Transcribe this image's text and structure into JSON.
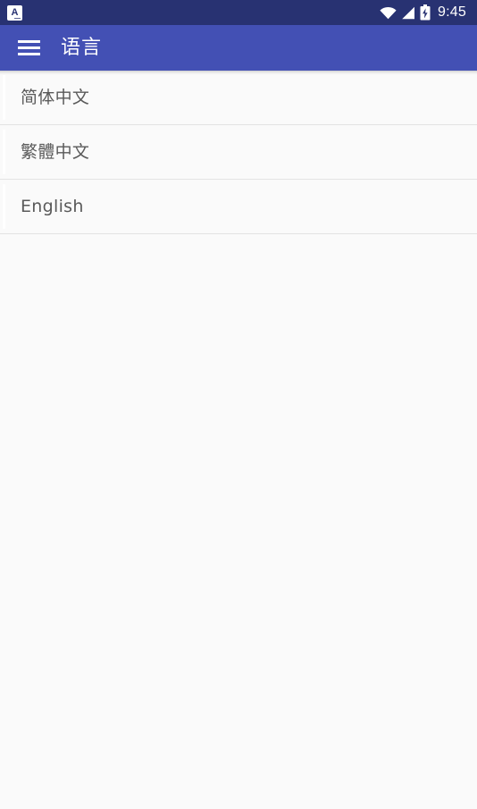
{
  "status_bar": {
    "notification_icon": "app-notification-icon",
    "notification_glyph": "A",
    "wifi_icon": "wifi-icon",
    "signal_icon": "cellular-signal-icon",
    "battery_icon": "battery-charging-icon",
    "time": "9:45",
    "background_color": "#283272",
    "foreground_color": "#ffffff"
  },
  "app_bar": {
    "menu_icon": "hamburger-menu-icon",
    "title": "语言",
    "background_color": "#4350b4",
    "text_color": "#ffffff"
  },
  "list": {
    "background_color": "#fafafa",
    "divider_color": "#e3e3e3",
    "text_color": "#5a5a5a",
    "items": [
      {
        "label": "简体中文",
        "name": "language-option-simplified-chinese"
      },
      {
        "label": "繁體中文",
        "name": "language-option-traditional-chinese"
      },
      {
        "label": "English",
        "name": "language-option-english"
      }
    ]
  }
}
